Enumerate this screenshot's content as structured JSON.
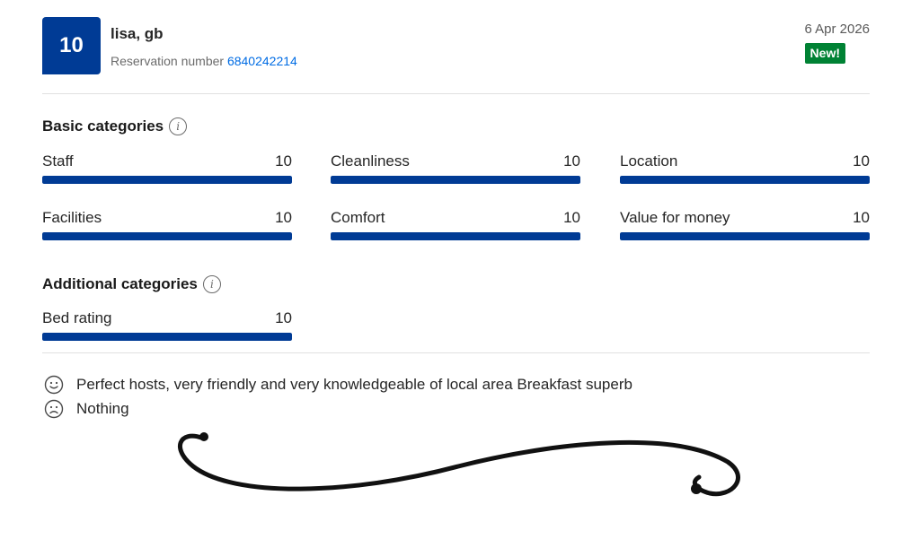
{
  "review": {
    "score": "10",
    "guest_name": "lisa, gb",
    "reservation_label": "Reservation number",
    "reservation_number": "6840242214",
    "date": "6 Apr 2026",
    "badge": "New!"
  },
  "basic": {
    "title": "Basic categories",
    "categories": [
      {
        "label": "Staff",
        "value": "10",
        "fill": 1.0
      },
      {
        "label": "Cleanliness",
        "value": "10",
        "fill": 1.0
      },
      {
        "label": "Location",
        "value": "10",
        "fill": 1.0
      },
      {
        "label": "Facilities",
        "value": "10",
        "fill": 1.0
      },
      {
        "label": "Comfort",
        "value": "10",
        "fill": 1.0
      },
      {
        "label": "Value for money",
        "value": "10",
        "fill": 1.0
      }
    ]
  },
  "additional": {
    "title": "Additional categories",
    "categories": [
      {
        "label": "Bed rating",
        "value": "10",
        "fill": 1.0
      }
    ]
  },
  "comments": {
    "positive": "Perfect hosts, very friendly and very knowledgeable of local area Breakfast superb",
    "negative": "Nothing"
  },
  "colors": {
    "brand_blue": "#003b95",
    "link_blue": "#006ce4",
    "badge_green": "#008234"
  },
  "icons": {
    "info": "info-icon",
    "positive": "smiley-face-icon",
    "negative": "sad-face-icon"
  }
}
